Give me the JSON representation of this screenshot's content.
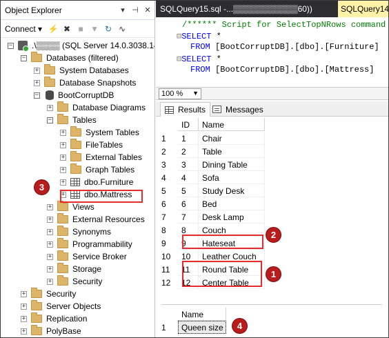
{
  "object_explorer": {
    "title": "Object Explorer",
    "title_controls": [
      "▾",
      "⊣",
      "✕"
    ],
    "toolbar": {
      "connect_label": "Connect"
    },
    "tree": [
      {
        "label": ".\\▒▒▒▒ (SQL Server 14.0.3038.14 -",
        "icon": "server-icon",
        "expander": "⊟"
      },
      {
        "label": "Databases (filtered)",
        "icon": "folder-icon",
        "expander": "⊟"
      },
      {
        "label": "System Databases",
        "icon": "folder-icon",
        "expander": "⊞"
      },
      {
        "label": "Database Snapshots",
        "icon": "folder-icon",
        "expander": "⊞"
      },
      {
        "label": "BootCorruptDB",
        "icon": "database-icon",
        "expander": "⊟"
      },
      {
        "label": "Database Diagrams",
        "icon": "folder-icon",
        "expander": "⊞"
      },
      {
        "label": "Tables",
        "icon": "folder-icon",
        "expander": "⊟"
      },
      {
        "label": "System Tables",
        "icon": "folder-icon",
        "expander": "⊞"
      },
      {
        "label": "FileTables",
        "icon": "folder-icon",
        "expander": "⊞"
      },
      {
        "label": "External Tables",
        "icon": "folder-icon",
        "expander": "⊞"
      },
      {
        "label": "Graph Tables",
        "icon": "folder-icon",
        "expander": "⊞"
      },
      {
        "label": "dbo.Furniture",
        "icon": "table-icon",
        "expander": "⊞"
      },
      {
        "label": "dbo.Mattress",
        "icon": "table-icon",
        "expander": "⊞"
      },
      {
        "label": "Views",
        "icon": "folder-icon",
        "expander": "⊞"
      },
      {
        "label": "External Resources",
        "icon": "folder-icon",
        "expander": "⊞"
      },
      {
        "label": "Synonyms",
        "icon": "folder-icon",
        "expander": "⊞"
      },
      {
        "label": "Programmability",
        "icon": "folder-icon",
        "expander": "⊞"
      },
      {
        "label": "Service Broker",
        "icon": "folder-icon",
        "expander": "⊞"
      },
      {
        "label": "Storage",
        "icon": "folder-icon",
        "expander": "⊞"
      },
      {
        "label": "Security",
        "icon": "folder-icon",
        "expander": "⊞"
      },
      {
        "label": "Security",
        "icon": "folder-icon",
        "expander": "⊞"
      },
      {
        "label": "Server Objects",
        "icon": "folder-icon",
        "expander": "⊞"
      },
      {
        "label": "Replication",
        "icon": "folder-icon",
        "expander": "⊞"
      },
      {
        "label": "PolyBase",
        "icon": "folder-icon",
        "expander": "⊞"
      }
    ]
  },
  "document": {
    "tab_title": "SQLQuery15.sql -...▒▒▒▒▒▒▒▒▒▒▒60))",
    "tab_title_2": "SQLQuery14",
    "editor_lines": [
      {
        "parts": [
          {
            "cls": "cm",
            "text": "/****** Script for SelectTopNRows command"
          }
        ]
      },
      {
        "parts": [
          {
            "cls": "gl",
            "text": "⊟"
          },
          {
            "cls": "kw",
            "text": "SELECT"
          },
          {
            "cls": "",
            "text": " *"
          }
        ]
      },
      {
        "parts": [
          {
            "cls": "kw",
            "text": "FROM"
          },
          {
            "cls": "",
            "text": " [BootCorruptDB].[dbo].[Furniture]"
          }
        ]
      },
      {
        "parts": [
          {
            "cls": "gl",
            "text": "⊟"
          },
          {
            "cls": "kw",
            "text": "SELECT"
          },
          {
            "cls": "",
            "text": " *"
          }
        ]
      },
      {
        "parts": [
          {
            "cls": "kw",
            "text": "FROM"
          },
          {
            "cls": "",
            "text": " [BootCorruptDB].[dbo].[Mattress]"
          }
        ]
      }
    ],
    "zoom": "100 %",
    "result_tabs": {
      "results": "Results",
      "messages": "Messages"
    },
    "grid1": {
      "columns": [
        "ID",
        "Name"
      ],
      "rows": [
        [
          "1",
          "1",
          "Chair"
        ],
        [
          "2",
          "2",
          "Table"
        ],
        [
          "3",
          "3",
          "Dining Table"
        ],
        [
          "4",
          "4",
          "Sofa"
        ],
        [
          "5",
          "5",
          "Study Desk"
        ],
        [
          "6",
          "6",
          "Bed"
        ],
        [
          "7",
          "7",
          "Desk Lamp"
        ],
        [
          "8",
          "8",
          "Couch"
        ],
        [
          "9",
          "9",
          "Hateseat"
        ],
        [
          "10",
          "10",
          "Leather Couch"
        ],
        [
          "11",
          "11",
          "Round Table"
        ],
        [
          "12",
          "12",
          "Center Table"
        ]
      ]
    },
    "grid2": {
      "columns": [
        "Name"
      ],
      "rows": [
        [
          "1",
          "Queen size"
        ]
      ]
    }
  },
  "annotations": {
    "badges": [
      "1",
      "2",
      "3",
      "4"
    ],
    "callout_color": "#e52b2b",
    "badge_color": "#b91c1c"
  }
}
